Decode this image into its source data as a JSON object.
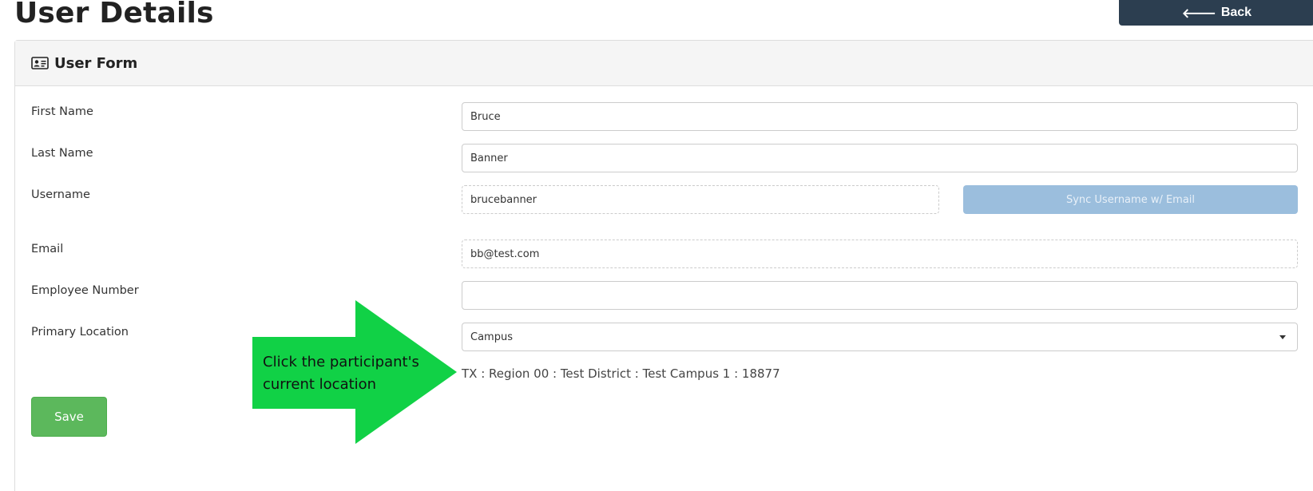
{
  "page": {
    "title": "User Details",
    "back_label": "Back"
  },
  "card": {
    "title": "User Form"
  },
  "form": {
    "first_name_label": "First Name",
    "first_name_value": "Bruce",
    "last_name_label": "Last Name",
    "last_name_value": "Banner",
    "username_label": "Username",
    "username_value": "brucebanner",
    "sync_button_label": "Sync Username w/ Email",
    "email_label": "Email",
    "email_value": "bb@test.com",
    "employee_number_label": "Employee Number",
    "employee_number_value": "",
    "primary_location_label": "Primary Location",
    "primary_location_value": "Campus",
    "location_path": "TX : Region 00 : Test District : Test Campus 1 : 18877",
    "save_label": "Save"
  },
  "annotation": {
    "text": "Click the participant's current location",
    "color": "#11d146"
  },
  "colors": {
    "back_button": "#2c3e50",
    "save_button": "#5cb85c",
    "sync_button_disabled": "#9bbedd"
  }
}
